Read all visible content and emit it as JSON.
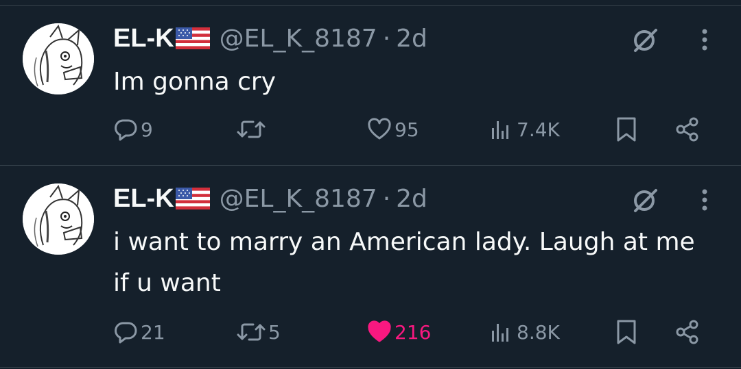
{
  "colors": {
    "background": "#15202b",
    "text": "#f7f9f9",
    "secondary": "#8b98a5",
    "divider": "#38444d",
    "like_active": "#f91880"
  },
  "tweets": [
    {
      "author": {
        "name": "EL-K",
        "flag": "us-flag-emoji",
        "handle": "@EL_K_8187"
      },
      "dot": "·",
      "time": "2d",
      "text": "Im gonna cry",
      "reply_count": "9",
      "repost_count": "",
      "like_count": "95",
      "liked": false,
      "view_count": "7.4K"
    },
    {
      "author": {
        "name": "EL-K",
        "flag": "us-flag-emoji",
        "handle": "@EL_K_8187"
      },
      "dot": "·",
      "time": "2d",
      "text": "i want to marry an American lady. Laugh at me if u want",
      "reply_count": "21",
      "repost_count": "5",
      "like_count": "216",
      "liked": true,
      "view_count": "8.8K"
    }
  ]
}
